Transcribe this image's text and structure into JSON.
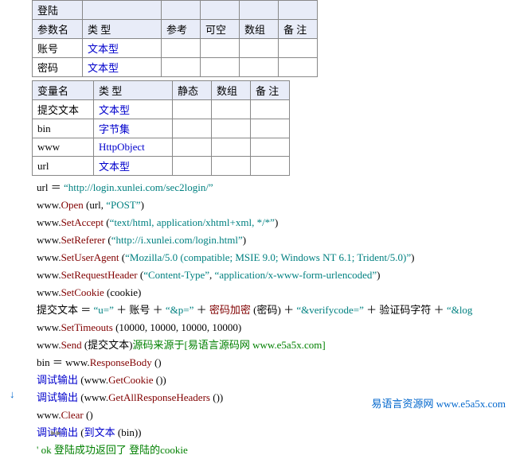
{
  "t1": {
    "r0": "登陆",
    "h": {
      "c1": "参数名",
      "c2": "类 型",
      "c3": "参考",
      "c4": "可空",
      "c5": "数组",
      "c6": "备 注"
    },
    "rows": [
      {
        "c1": "账号",
        "c2": "文本型"
      },
      {
        "c1": "密码",
        "c2": "文本型"
      }
    ]
  },
  "t2": {
    "h": {
      "c1": "变量名",
      "c2": "类 型",
      "c3": "静态",
      "c4": "数组",
      "c5": "备 注"
    },
    "rows": [
      {
        "c1": "提交文本",
        "c2": "文本型"
      },
      {
        "c1": "bin",
        "c2": "字节集"
      },
      {
        "c1": "www",
        "c2": "HttpObject"
      },
      {
        "c1": "url",
        "c2": "文本型"
      }
    ]
  },
  "code": {
    "l1": {
      "a": "url ＝ ",
      "b": "“http://login.xunlei.com/sec2login/”"
    },
    "l2": {
      "a": "www.",
      "b": "Open",
      "c": " (url, ",
      "d": "“POST”",
      "e": ")"
    },
    "l3": {
      "a": "www.",
      "b": "SetAccept",
      "c": " (",
      "d": "“text/html, application/xhtml+xml, */*”",
      "e": ")"
    },
    "l4": {
      "a": "www.",
      "b": "SetReferer",
      "c": " (",
      "d": "“http://i.xunlei.com/login.html”",
      "e": ")"
    },
    "l5": {
      "a": "www.",
      "b": "SetUserAgent",
      "c": " (",
      "d": "“Mozilla/5.0 (compatible; MSIE 9.0; Windows NT 6.1; Trident/5.0)”",
      "e": ")"
    },
    "l6": {
      "a": "www.",
      "b": "SetRequestHeader",
      "c": " (",
      "d": "“Content-Type”",
      "e": ", ",
      "f": "“application/x-www-form-urlencoded”",
      "g": ")"
    },
    "l7": {
      "a": "www.",
      "b": "SetCookie",
      "c": " (cookie)"
    },
    "l8": {
      "a": "提交文本 ＝ ",
      "b": "“u=”",
      "c": " ＋ 账号 ＋ ",
      "d": "“&p=”",
      "e": " ＋ ",
      "f": "密码加密",
      "g": " (密码) ＋ ",
      "h": "“&verifycode=”",
      "i": " ＋ 验证码字符 ＋ ",
      "j": "“&log"
    },
    "l9": {
      "a": "www.",
      "b": "SetTimeouts",
      "c": " (10000, 10000, 10000, 10000)"
    },
    "l10": {
      "a": "www.",
      "b": "Send",
      "c": " (提交文本)",
      "d": "源码来源于[易语言源码网  www.e5a5x.com]"
    },
    "l11": {
      "a": "bin ＝ www.",
      "b": "ResponseBody",
      "c": " ()"
    },
    "l12": {
      "a": "调试输出",
      "b": " (www.",
      "c": "GetCookie",
      "d": " ())"
    },
    "l13": {
      "a": "调试输出",
      "b": " (www.",
      "c": "GetAllResponseHeaders",
      "d": " ())"
    },
    "l14": {
      "a": "www.",
      "b": "Clear",
      "c": " ()"
    },
    "l15": {
      "a": "调试输出",
      "b": " (",
      "c": "到文本",
      "d": " (bin))"
    },
    "l16": "' ok  登陆成功返回了 登陆的cookie"
  },
  "footer": "易语言资源网  www.e5a5x.com",
  "arrow1": "▸▸",
  "arrow2": "↓"
}
